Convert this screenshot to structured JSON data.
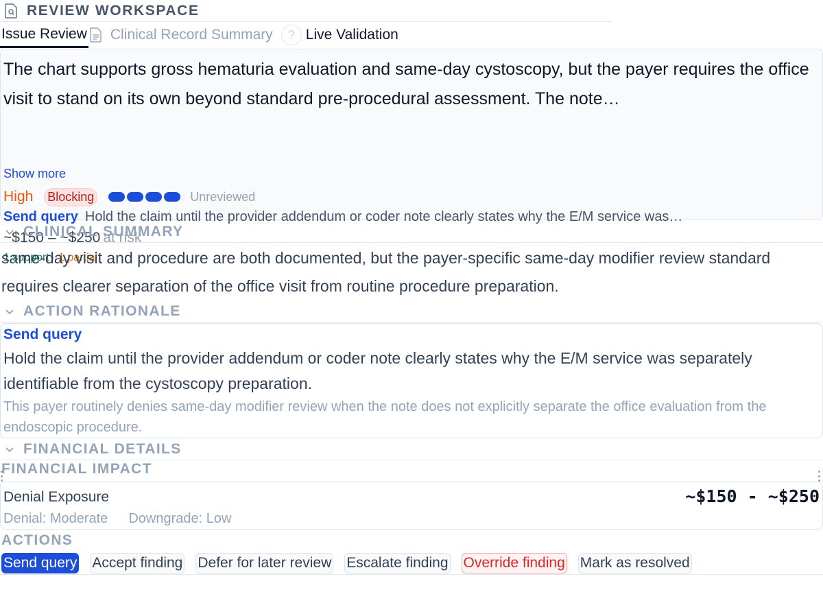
{
  "header": {
    "title": "REVIEW WORKSPACE",
    "icon": "document-search-icon"
  },
  "tabs": [
    {
      "label": "Issue Review",
      "active": true
    },
    {
      "label": "Clinical Record Summary",
      "active": false,
      "icon": "document-icon"
    },
    {
      "label": "Live Validation",
      "active": false,
      "icon": "question-icon"
    }
  ],
  "finding": {
    "description": "The chart supports gross hematuria evaluation and same-day cystoscopy, but the payer requires the office visit to stand on its own beyond standard pre-procedural assessment. The note…",
    "show_more": "Show more",
    "severity": "High",
    "blocking": "Blocking",
    "confidence_level": 4,
    "status": "Unreviewed",
    "action_label": "Send query",
    "action_text": "Hold the claim until the provider addendum or coder note clearly states why the E/M service was…",
    "risk_amount": "~$150 – ~$250",
    "risk_suffix": "at risk",
    "evidence_support": "1 support",
    "evidence_sep": "·",
    "evidence_partial": "1 partial"
  },
  "clinical_summary": {
    "title": "CLINICAL SUMMARY",
    "text": "same-day visit and procedure are both documented, but the payer-specific same-day modifier review standard requires clearer separation of the office visit from routine procedure preparation."
  },
  "action_rationale": {
    "title": "ACTION RATIONALE",
    "label": "Send query",
    "text": "Hold the claim until the provider addendum or coder note clearly states why the E/M service was separately identifiable from the cystoscopy preparation.",
    "note": "This payer routinely denies same-day modifier review when the note does not explicitly separate the office evaluation from the endoscopic procedure."
  },
  "financial_details": {
    "title": "FINANCIAL DETAILS",
    "impact_title": "FINANCIAL IMPACT",
    "exposure_label": "Denial Exposure",
    "amount": "~$150 - ~$250",
    "denial": "Denial: Moderate",
    "downgrade": "Downgrade: Low"
  },
  "actions": {
    "title": "ACTIONS",
    "buttons": {
      "send_query": "Send query",
      "accept": "Accept finding",
      "defer": "Defer for later review",
      "escalate": "Escalate finding",
      "override": "Override finding",
      "resolve": "Mark as resolved"
    }
  },
  "colors": {
    "accent": "#1d4ed8",
    "severity_high": "#ea580c",
    "blocking_bg": "#fee2e2",
    "blocking_text": "#b91c1c",
    "support": "#059669",
    "partial": "#d97706",
    "danger": "#dc2626"
  }
}
